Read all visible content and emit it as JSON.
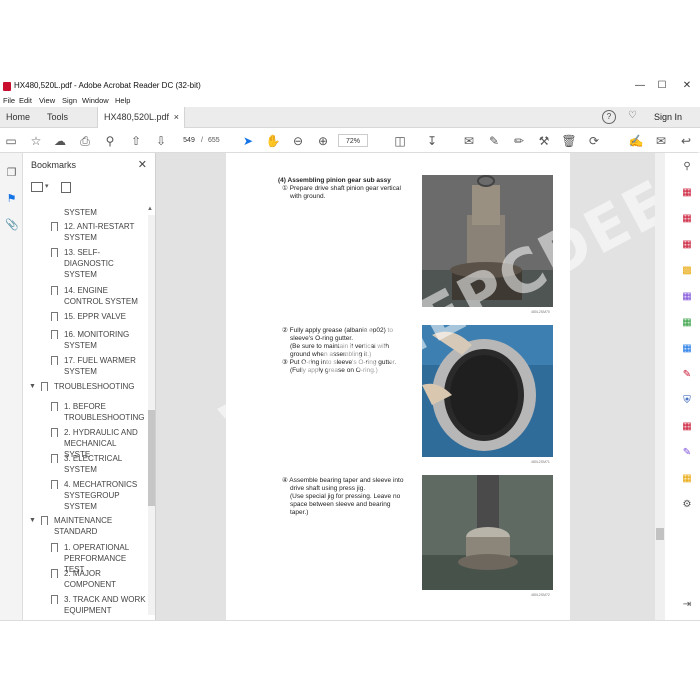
{
  "window": {
    "title": "HX480,520L.pdf - Adobe Acrobat Reader DC (32-bit)",
    "controls": {
      "minimize": "—",
      "maximize": "☐",
      "close": "✕"
    }
  },
  "menu": [
    "File",
    "Edit",
    "View",
    "Sign",
    "Window",
    "Help"
  ],
  "tabs": {
    "home": "Home",
    "tools": "Tools",
    "document": "HX480,520L.pdf",
    "close": "×"
  },
  "topright": {
    "help": "?",
    "bell": "🔔",
    "signin": "Sign In"
  },
  "toolbar": {
    "current_page": "549",
    "page_sep": "/",
    "total_pages": "655",
    "zoom": "72%"
  },
  "bookmarks": {
    "title": "Bookmarks",
    "close": "✕",
    "items": [
      {
        "label": "SYSTEM"
      },
      {
        "label": "12. ANTI-RESTART SYSTEM"
      },
      {
        "label": "13. SELF-DIAGNOSTIC SYSTEM"
      },
      {
        "label": "14. ENGINE CONTROL SYSTEM"
      },
      {
        "label": "15. EPPR VALVE"
      },
      {
        "label": "16. MONITORING SYSTEM"
      },
      {
        "label": "17. FUEL WARMER SYSTEM"
      },
      {
        "label": "TROUBLESHOOTING"
      },
      {
        "label": "1. BEFORE TROUBLESHOOTING"
      },
      {
        "label": "2. HYDRAULIC AND MECHANICAL SYSTE"
      },
      {
        "label": "3. ELECTRICAL SYSTEM"
      },
      {
        "label": "4. MECHATRONICS SYSTEGROUP SYSTEM"
      },
      {
        "label": "MAINTENANCE STANDARD"
      },
      {
        "label": "1. OPERATIONAL PERFORMANCE TEST"
      },
      {
        "label": "2. MAJOR COMPONENT"
      },
      {
        "label": "3. TRACK AND WORK EQUIPMENT"
      }
    ]
  },
  "document": {
    "heading": "(4) Assembling pinion gear sub assy",
    "step1": [
      "① Prepare drive shaft pinion gear vertical",
      "with ground."
    ],
    "step2": [
      "② Fully apply grease (albania ep02) to",
      "sleeve's O-ring gutter.",
      "(Be sure to maintain it vertical with",
      "ground when assembling it.)",
      "③ Put O-ring into sleeve's O-ring gutter.",
      "(Fully apply grease on O-ring.)"
    ],
    "step3": [
      "④ Assemble bearing taper and sleeve into",
      "drive shaft using press jig.",
      "(Use special jig for pressing. Leave no",
      "space between sleeve and bearing",
      "taper.)"
    ],
    "captions": [
      "480L2SM70",
      "480L2SM71",
      "480L2SM72"
    ]
  },
  "watermark": "WWW.EPCDEE.COM",
  "colors": {
    "accent_blue": "#1473e6",
    "red": "#c8102e"
  }
}
